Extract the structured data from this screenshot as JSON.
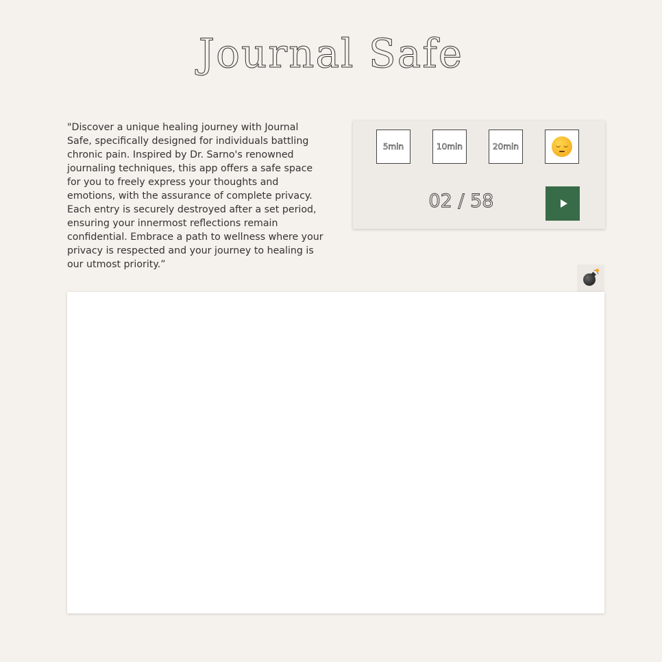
{
  "app": {
    "title": "Journal Safe"
  },
  "intro": {
    "text": "\"Discover a unique healing journey with Journal Safe, specifically designed for individuals battling chronic pain. Inspired by Dr. Sarno's renowned journaling techniques, this app offers a safe space for you to freely express your thoughts and emotions, with the assurance of complete privacy. Each entry is securely destroyed after a set period, ensuring your innermost reflections remain confidential. Embrace a path to wellness where your privacy is respected and your journey to healing is our utmost priority.”"
  },
  "controls": {
    "timers": [
      {
        "label": "5min"
      },
      {
        "label": "10min"
      },
      {
        "label": "20min"
      }
    ],
    "mood": {
      "icon": "pensive-face-icon"
    },
    "counter": "02 / 58",
    "play": {
      "icon": "play-icon",
      "color": "#386b48"
    }
  },
  "destroy": {
    "icon": "bomb-icon"
  },
  "editor": {
    "value": "",
    "placeholder": ""
  },
  "colors": {
    "background": "#f5f1ec",
    "panel": "#eeebe6",
    "accent": "#386b48"
  }
}
